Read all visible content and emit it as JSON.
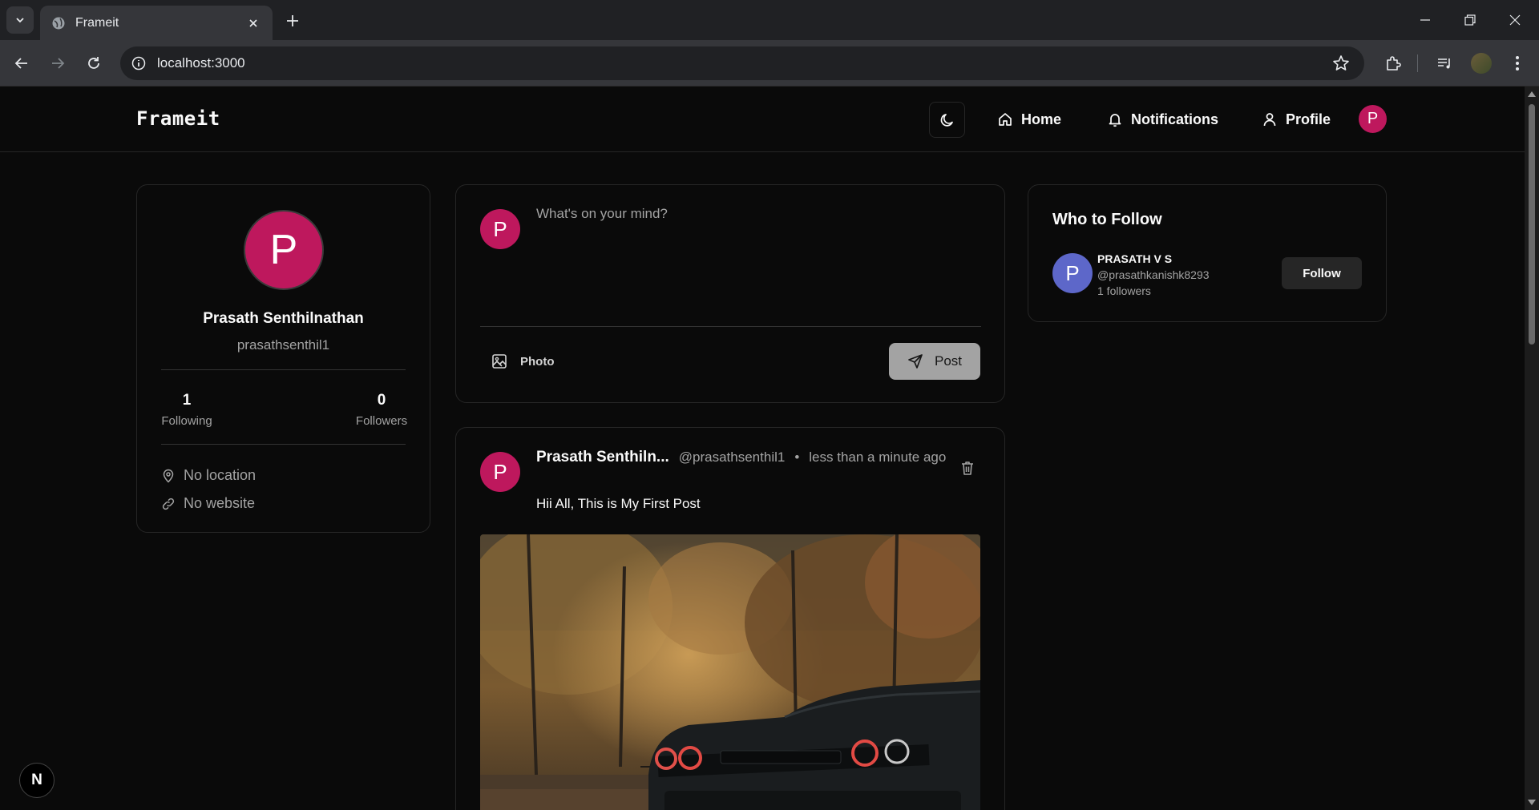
{
  "browser": {
    "tab_title": "Frameit",
    "url": "localhost:3000"
  },
  "header": {
    "brand": "Frameit",
    "nav": {
      "home": "Home",
      "notifications": "Notifications",
      "profile": "Profile"
    },
    "avatar_initial": "P"
  },
  "profile": {
    "initial": "P",
    "name": "Prasath Senthilnathan",
    "handle": "prasathsenthil1",
    "following_count": "1",
    "following_label": "Following",
    "followers_count": "0",
    "followers_label": "Followers",
    "location": "No location",
    "website": "No website"
  },
  "composer": {
    "initial": "P",
    "placeholder": "What's on your mind?",
    "photo_label": "Photo",
    "post_label": "Post"
  },
  "post": {
    "initial": "P",
    "author": "Prasath Senthiln...",
    "handle": "@prasathsenthil1",
    "separator": "•",
    "time": "less than a minute ago",
    "text": "Hii All, This is My First Post"
  },
  "who_to_follow": {
    "title": "Who to Follow",
    "users": [
      {
        "initial": "P",
        "name": "PRASATH V S",
        "handle": "@prasathkanishk8293",
        "followers": "1 followers",
        "button": "Follow"
      }
    ]
  },
  "dev_badge": "N",
  "colors": {
    "accent_avatar": "#be185d",
    "suggested_avatar": "#5d67c9",
    "background": "#0a0a0a"
  }
}
